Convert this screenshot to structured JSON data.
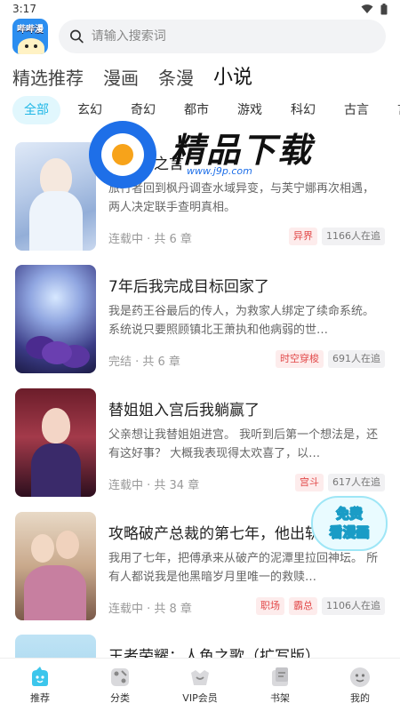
{
  "status_bar": {
    "time": "3:17"
  },
  "header": {
    "logo_text": "哔哔漫",
    "search_placeholder": "请输入搜索词"
  },
  "main_tabs": [
    {
      "label": "精选推荐",
      "active": false
    },
    {
      "label": "漫画",
      "active": false
    },
    {
      "label": "条漫",
      "active": false
    },
    {
      "label": "小说",
      "active": true
    }
  ],
  "genres": [
    {
      "label": "全部",
      "active": true
    },
    {
      "label": "玄幻",
      "active": false
    },
    {
      "label": "奇幻",
      "active": false
    },
    {
      "label": "都市",
      "active": false
    },
    {
      "label": "游戏",
      "active": false
    },
    {
      "label": "科幻",
      "active": false
    },
    {
      "label": "古言",
      "active": false
    },
    {
      "label": "言",
      "active": false
    }
  ],
  "books": [
    {
      "title": "原初神之言",
      "desc": "旅行者回到枫丹调查水域异变，与芙宁娜再次相遇，两人决定联手查明真相。",
      "meta": "连载中 · 共 6 章",
      "tags": [
        "异界"
      ],
      "readers": "1166人在追"
    },
    {
      "title": "7年后我完成目标回家了",
      "desc": "我是药王谷最后的传人，为救家人绑定了续命系统。 系统说只要照顾镇北王萧执和他病弱的世…",
      "meta": "完结 · 共 6 章",
      "tags": [
        "时空穿梭"
      ],
      "readers": "691人在追"
    },
    {
      "title": "替姐姐入宫后我躺赢了",
      "desc": "父亲想让我替姐姐进宫。 我听到后第一个想法是，还有这好事？ 大概我表现得太欢喜了，以…",
      "meta": "连载中 · 共 34 章",
      "tags": [
        "宫斗"
      ],
      "readers": "617人在追"
    },
    {
      "title": "攻略破产总裁的第七年，他出轨了",
      "desc": "我用了七年，把傅承来从破产的泥潭里拉回神坛。 所有人都说我是他黑暗岁月里唯一的救赎…",
      "meta": "连载中 · 共 8 章",
      "tags": [
        "职场",
        "霸总"
      ],
      "readers": "1106人在追"
    },
    {
      "title": "王者荣耀：人鱼之歌（扩写版）",
      "desc": "",
      "meta": "",
      "tags": [],
      "readers": ""
    }
  ],
  "watermark": {
    "text": "精品下载",
    "url": "www.j9p.com"
  },
  "free_badge": {
    "line1": "免费",
    "line2": "看漫画"
  },
  "bottom_nav": [
    {
      "label": "推荐",
      "icon": "recommend-icon",
      "active": true
    },
    {
      "label": "分类",
      "icon": "category-icon",
      "active": false
    },
    {
      "label": "VIP会员",
      "icon": "vip-icon",
      "active": false
    },
    {
      "label": "书架",
      "icon": "bookshelf-icon",
      "active": false
    },
    {
      "label": "我的",
      "icon": "profile-icon",
      "active": false
    }
  ],
  "colors": {
    "accent": "#20b7e6",
    "accent_bg": "#e1f7fd",
    "tag_red": "#e24a4a",
    "tag_red_bg": "#fdecec"
  }
}
